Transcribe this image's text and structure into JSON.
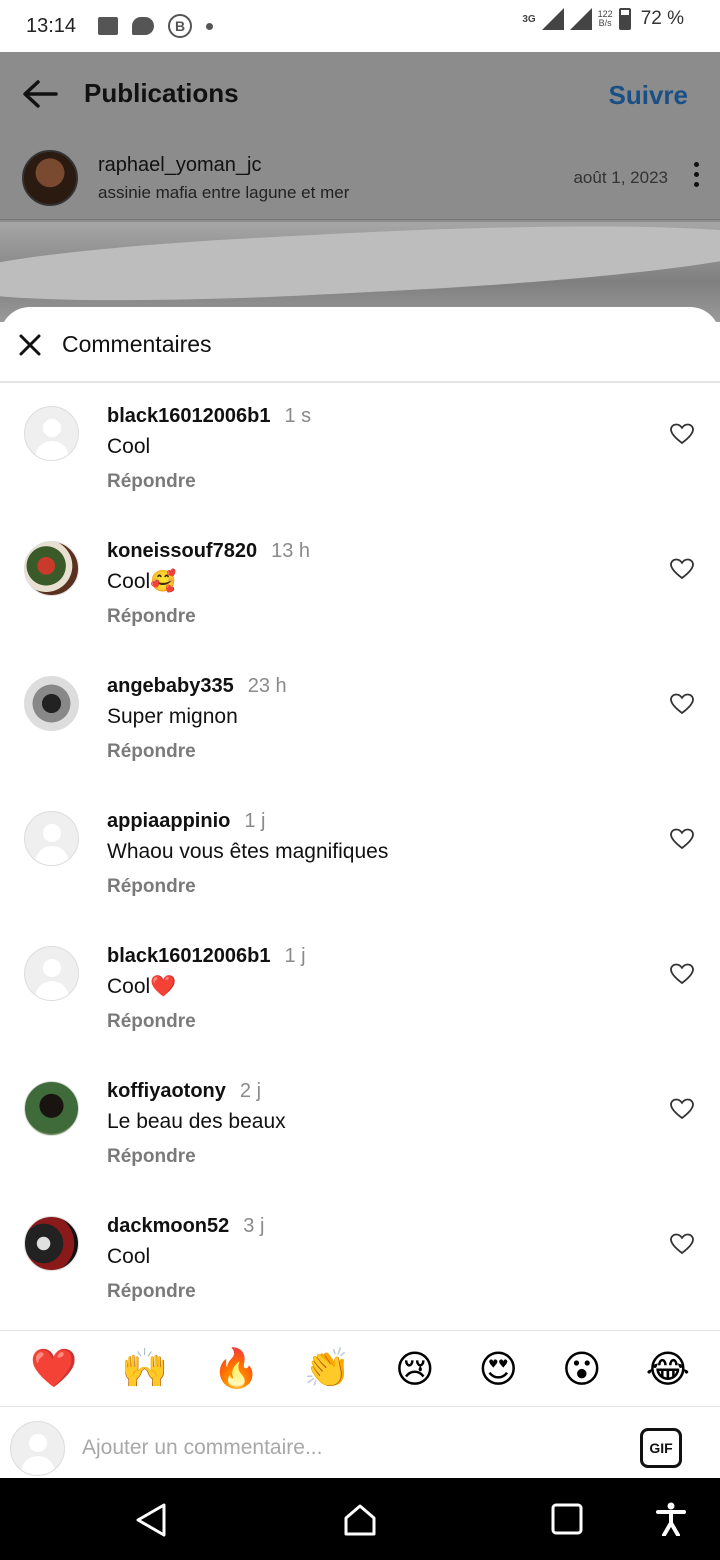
{
  "status_bar": {
    "time": "13:14",
    "network": "3G",
    "speed_value": "122",
    "speed_unit": "B/s",
    "battery": "72 %"
  },
  "header": {
    "title": "Publications",
    "follow_label": "Suivre"
  },
  "post": {
    "author": "raphael_yoman_jc",
    "location": "assinie mafia entre lagune et mer",
    "date": "août 1, 2023"
  },
  "sheet": {
    "title": "Commentaires"
  },
  "comments": [
    {
      "user": "black16012006b1",
      "time": "1 s",
      "text": "Cool",
      "reply": "Répondre",
      "avatar": "default"
    },
    {
      "user": "koneissouf7820",
      "time": "13 h",
      "text": "Cool🥰",
      "reply": "Répondre",
      "avatar": "photo"
    },
    {
      "user": "angebaby335",
      "time": "23 h",
      "text": "Super mignon",
      "reply": "Répondre",
      "avatar": "photo"
    },
    {
      "user": "appiaappinio",
      "time": "1 j",
      "text": "Whaou vous êtes magnifiques",
      "reply": "Répondre",
      "avatar": "default"
    },
    {
      "user": "black16012006b1",
      "time": "1 j",
      "text": "Cool❤️",
      "reply": "Répondre",
      "avatar": "default"
    },
    {
      "user": "koffiyaotony",
      "time": "2 j",
      "text": "Le beau des beaux",
      "reply": "Répondre",
      "avatar": "photo"
    },
    {
      "user": "dackmoon52",
      "time": "3 j",
      "text": "Cool",
      "reply": "Répondre",
      "avatar": "photo"
    }
  ],
  "emoji_bar": [
    "❤️",
    "🙌",
    "🔥",
    "👏",
    "😢",
    "😍",
    "😮",
    "😂"
  ],
  "input": {
    "placeholder": "Ajouter un commentaire...",
    "gif_label": "GIF"
  },
  "colors": {
    "follow": "#1a4f86",
    "overlay": "#8c8c8c",
    "muted": "#8a8a8a"
  }
}
